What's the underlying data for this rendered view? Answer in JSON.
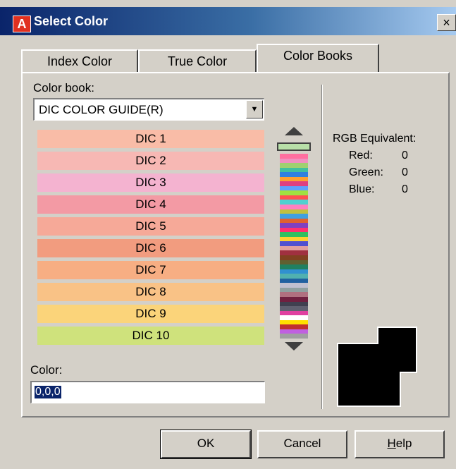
{
  "window": {
    "title": "Select Color",
    "app_icon_letter": "A",
    "close_glyph": "×"
  },
  "tabs": [
    {
      "label": "Index Color",
      "active": false
    },
    {
      "label": "True Color",
      "active": false
    },
    {
      "label": "Color Books",
      "active": true
    }
  ],
  "color_book": {
    "label": "Color book:",
    "value": "DIC COLOR GUIDE(R)"
  },
  "swatches": [
    {
      "label": "DIC 1",
      "color": "#f9bca7"
    },
    {
      "label": "DIC 2",
      "color": "#f7b8b4"
    },
    {
      "label": "DIC 3",
      "color": "#f4b3d0"
    },
    {
      "label": "DIC 4",
      "color": "#f39aa4"
    },
    {
      "label": "DIC 5",
      "color": "#f6a998"
    },
    {
      "label": "DIC 6",
      "color": "#f29c7f"
    },
    {
      "label": "DIC 7",
      "color": "#f7ae83"
    },
    {
      "label": "DIC 8",
      "color": "#f9c286"
    },
    {
      "label": "DIC 9",
      "color": "#fbd47a"
    },
    {
      "label": "DIC 10",
      "color": "#cfe27c"
    }
  ],
  "rgb": {
    "heading": "RGB Equivalent:",
    "red_label": "Red:",
    "red_value": "0",
    "green_label": "Green:",
    "green_value": "0",
    "blue_label": "Blue:",
    "blue_value": "0"
  },
  "color_field": {
    "label": "Color:",
    "value": "0,0,0"
  },
  "buttons": {
    "ok": "OK",
    "cancel": "Cancel",
    "help_first": "H",
    "help_rest": "elp"
  },
  "preview_color": "#000000"
}
